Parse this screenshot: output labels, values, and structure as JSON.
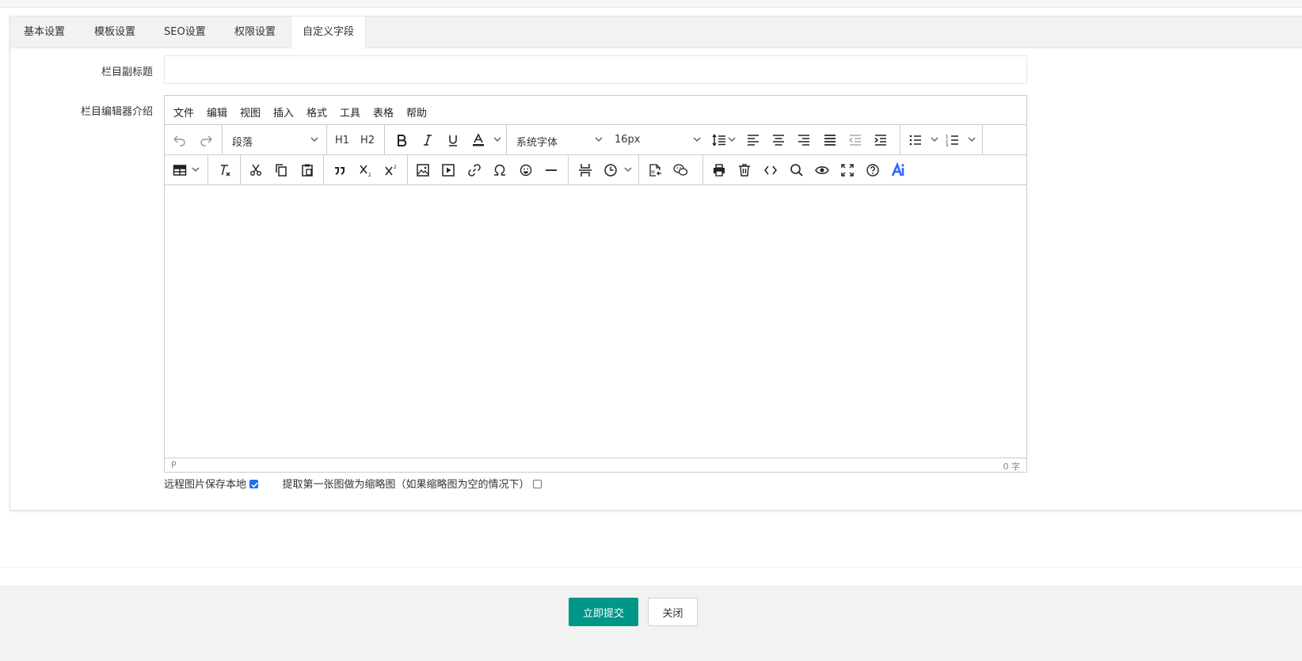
{
  "tabs": [
    {
      "label": "基本设置",
      "active": false
    },
    {
      "label": "模板设置",
      "active": false
    },
    {
      "label": "SEO设置",
      "active": false
    },
    {
      "label": "权限设置",
      "active": false
    },
    {
      "label": "自定义字段",
      "active": true
    }
  ],
  "form": {
    "subtitle_label": "栏目副标题",
    "subtitle_value": "",
    "editor_label": "栏目编辑器介绍"
  },
  "editor": {
    "menus": [
      "文件",
      "编辑",
      "视图",
      "插入",
      "格式",
      "工具",
      "表格",
      "帮助"
    ],
    "block_format": "段落",
    "h1": "H1",
    "h2": "H2",
    "font_family": "系统字体",
    "font_size": "16px",
    "path": "P",
    "word_count": "0 字",
    "accent_color": "#3366ff"
  },
  "options": {
    "save_remote_images_label": "远程图片保存本地",
    "save_remote_images_checked": true,
    "first_image_thumb_label": "提取第一张图做为缩略图（如果缩略图为空的情况下）",
    "first_image_thumb_checked": false
  },
  "footer": {
    "submit_label": "立即提交",
    "close_label": "关闭",
    "submit_color": "#009688"
  }
}
